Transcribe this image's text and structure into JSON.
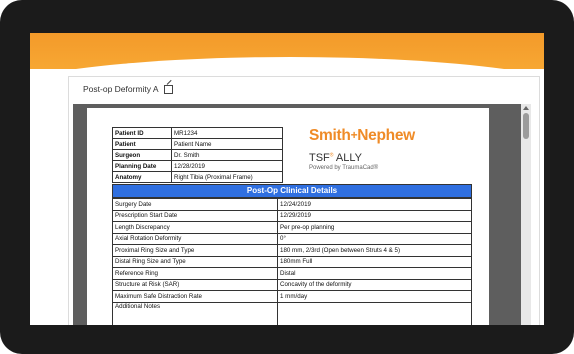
{
  "viewer": {
    "title": "Post-op Deformity A"
  },
  "patient_info": [
    {
      "label": "Patient ID",
      "value": "MR1234"
    },
    {
      "label": "Patient",
      "value": "Patient Name"
    },
    {
      "label": "Surgeon",
      "value": "Dr. Smith"
    },
    {
      "label": "Planning Date",
      "value": "12/28/2019"
    },
    {
      "label": "Anatomy",
      "value": "Right Tibia (Proximal Frame)"
    }
  ],
  "branding": {
    "company_part1": "Smith",
    "company_plus": "+",
    "company_part2": "Nephew",
    "product": "TSF",
    "product_mark": "®",
    "product_suffix": " ALLY",
    "powered_by": "Powered by TraumaCad®",
    "brand_color": "#ef8b27"
  },
  "clinical": {
    "header": "Post-Op Clinical Details",
    "header_color": "#2f6fe0",
    "rows": [
      {
        "label": "Surgery Date",
        "value": "12/24/2019"
      },
      {
        "label": "Prescription Start Date",
        "value": "12/29/2019"
      },
      {
        "label": "Length Discrepancy",
        "value": "Per pre-op planning"
      },
      {
        "label": "Axial Rotation Deformity",
        "value": "0°"
      },
      {
        "label": "Proximal Ring Size and Type",
        "value": "180 mm, 2/3rd (Open between Struts 4 & 5)"
      },
      {
        "label": "Distal Ring Size and Type",
        "value": "180mm Full"
      },
      {
        "label": "Reference Ring",
        "value": "Distal"
      },
      {
        "label": "Structure at Risk (SAR)",
        "value": "Concavity of the deformity"
      },
      {
        "label": "Maximum Safe Distraction Rate",
        "value": "1 mm/day"
      },
      {
        "label": "Additional Notes",
        "value": ""
      }
    ]
  },
  "colors": {
    "orange_bar": "#f39a2a",
    "bezel": "#1b1b1b"
  }
}
